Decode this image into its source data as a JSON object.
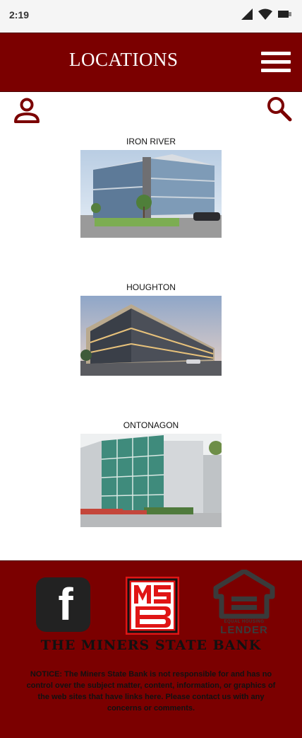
{
  "status_bar": {
    "time": "2:19"
  },
  "header": {
    "title": "LOCATIONS"
  },
  "locations": [
    {
      "name": "IRON RIVER"
    },
    {
      "name": "HOUGHTON"
    },
    {
      "name": "ONTONAGON"
    }
  ],
  "footer": {
    "msb_logo_text": "MSB",
    "ehl_text": "EQUAL HOUSING LENDER",
    "bank_name": "THE MINERS STATE BANK",
    "notice": "NOTICE: The Miners State Bank is not responsible for and has no control over the subject matter, content, information, or graphics of the web sites that have links here. Please contact us with any concerns or comments."
  },
  "colors": {
    "brand": "#7b0000",
    "header_text": "#ffffff"
  }
}
